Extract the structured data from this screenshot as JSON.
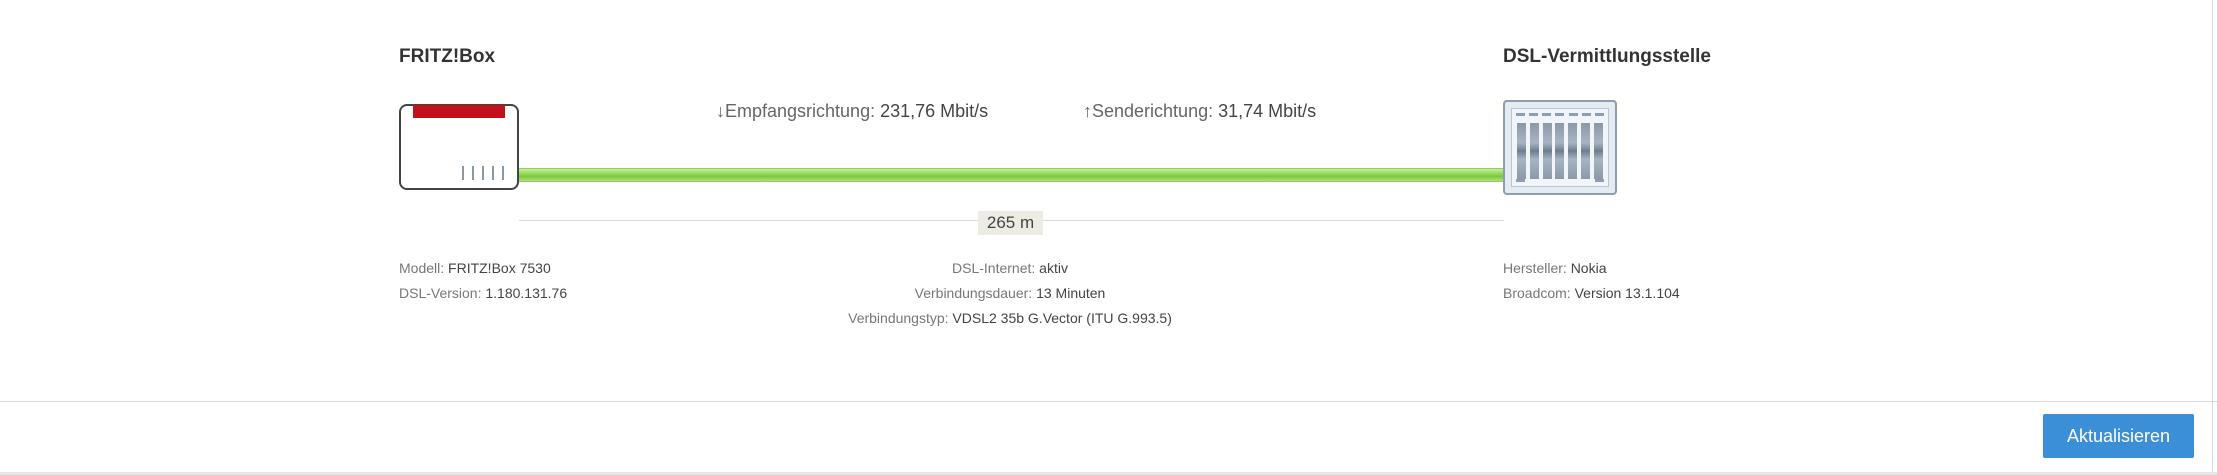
{
  "fritzbox": {
    "title": "FRITZ!Box",
    "model_label": "Modell:",
    "model_value": "FRITZ!Box 7530",
    "dslversion_label": "DSL-Version:",
    "dslversion_value": "1.180.131.76"
  },
  "exchange": {
    "title": "DSL-Vermittlungsstelle",
    "manufacturer_label": "Hersteller:",
    "manufacturer_value": "Nokia",
    "broadcom_label": "Broadcom:",
    "broadcom_value": "Version 13.1.104"
  },
  "rates": {
    "down_label": "↓Empfangsrichtung:",
    "down_value": "231,76 Mbit/s",
    "up_label": "↑Senderichtung:",
    "up_value": "31,74 Mbit/s"
  },
  "line": {
    "distance": "265 m"
  },
  "connection": {
    "internet_label": "DSL-Internet:",
    "internet_value": "aktiv",
    "duration_label": "Verbindungsdauer:",
    "duration_value": "13 Minuten",
    "type_label": "Verbindungstyp:",
    "type_value": "VDSL2 35b G.Vector (ITU G.993.5)"
  },
  "footer": {
    "refresh_label": "Aktualisieren"
  },
  "colors": {
    "line_green": "#8fd44f",
    "fritz_red": "#c3111b",
    "button_blue": "#3b8fd6"
  }
}
